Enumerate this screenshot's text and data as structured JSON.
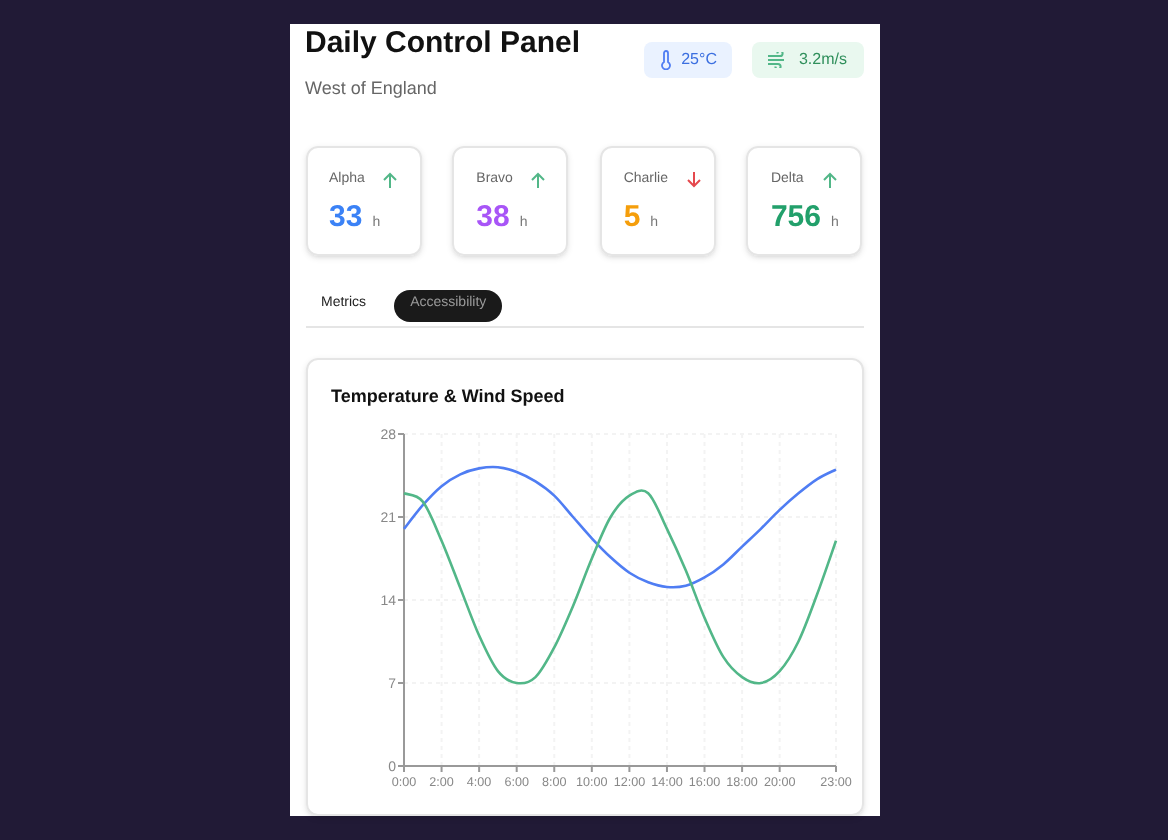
{
  "header": {
    "title": "Daily Control Panel",
    "subtitle": "West of England"
  },
  "badges": [
    {
      "kind": "temperature",
      "text": "25°C"
    },
    {
      "kind": "wind",
      "text": "3.2m/s"
    }
  ],
  "stats": [
    {
      "label": "Alpha",
      "rising": true,
      "value": "33",
      "unit": "h",
      "color": "#3b82f6"
    },
    {
      "label": "Bravo",
      "rising": true,
      "value": "38",
      "unit": "h",
      "color": "#a855f7"
    },
    {
      "label": "Charlie",
      "rising": false,
      "value": "5",
      "unit": "h",
      "color": "#f59e0b"
    },
    {
      "label": "Delta",
      "rising": true,
      "value": "756",
      "unit": "h",
      "color": "#22a06b"
    }
  ],
  "tabs": [
    {
      "label": "Metrics",
      "selected": false
    },
    {
      "label": "Accessibility",
      "selected": true
    }
  ],
  "chart_card": {
    "title": "Temperature & Wind Speed",
    "chart_data": {
      "type": "line",
      "x": [
        0,
        1,
        2,
        3,
        4,
        5,
        6,
        7,
        8,
        9,
        10,
        11,
        12,
        13,
        14,
        15,
        16,
        17,
        18,
        19,
        20,
        21,
        22,
        23
      ],
      "xticks": [
        {
          "value": 0,
          "label": "0:00"
        },
        {
          "value": 2,
          "label": "2:00"
        },
        {
          "value": 4,
          "label": "4:00"
        },
        {
          "value": 6,
          "label": "6:00"
        },
        {
          "value": 8,
          "label": "8:00"
        },
        {
          "value": 10,
          "label": "10:00"
        },
        {
          "value": 12,
          "label": "12:00"
        },
        {
          "value": 14,
          "label": "14:00"
        },
        {
          "value": 16,
          "label": "16:00"
        },
        {
          "value": 18,
          "label": "18:00"
        },
        {
          "value": 20,
          "label": "20:00"
        },
        {
          "value": 23,
          "label": "23:00"
        }
      ],
      "yticks": [
        0,
        7,
        14,
        21,
        28
      ],
      "xlim": [
        0,
        23
      ],
      "ylim": [
        0,
        28
      ],
      "grid": true,
      "series": [
        {
          "color": "#4f7df3",
          "values": [
            20,
            22,
            23.6,
            24.6,
            25.1,
            25.2,
            24.8,
            24,
            22.8,
            21,
            19.2,
            17.6,
            16.3,
            15.5,
            15.1,
            15.2,
            15.9,
            17,
            18.5,
            20,
            21.6,
            23,
            24.2,
            25
          ]
        },
        {
          "color": "#52b788",
          "values": [
            23,
            22.3,
            19,
            15,
            11,
            8,
            7,
            7.5,
            10,
            13.5,
            17.5,
            21,
            22.8,
            23,
            20,
            16.5,
            12.5,
            9.2,
            7.5,
            7,
            8,
            10.5,
            14.5,
            19
          ]
        }
      ]
    }
  }
}
